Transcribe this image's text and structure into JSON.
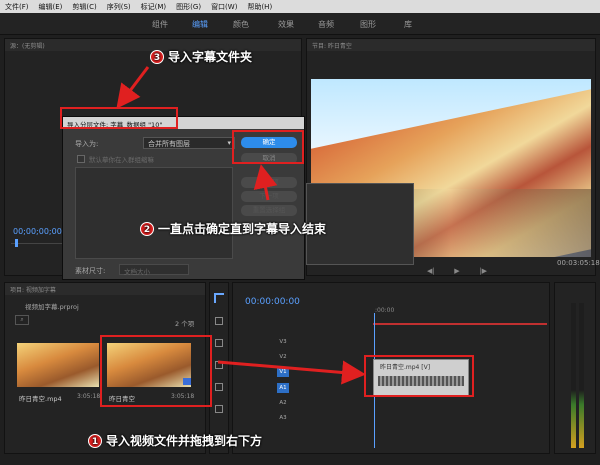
{
  "menu": [
    "文件(F)",
    "编辑(E)",
    "剪辑(C)",
    "序列(S)",
    "标记(M)",
    "图形(G)",
    "窗口(W)",
    "帮助(H)"
  ],
  "workspace_tabs": [
    "组件",
    "编辑",
    "颜色",
    "效果",
    "音频",
    "图形",
    "库"
  ],
  "source_panel": {
    "title": "源：(无剪辑)",
    "timecode": "00;00;00;00"
  },
  "program_panel": {
    "title": "节目: 昨日青空",
    "timecode_end": "00:03:05:18"
  },
  "dialog": {
    "title": "导入分层文件: 字幕_数据组 \"10\"",
    "import_as_label": "导入为:",
    "import_as_value": "合并所有图层",
    "checkbox_label": "默认摹你在入群组缩嘛",
    "footage_size_label": "素材尺寸:",
    "footage_size_value": "文档大小",
    "ok_label": "确定",
    "cancel_label": "取消",
    "prev_label": "上一项",
    "next_label": "下一项",
    "reset_label": "重置选择组"
  },
  "project_panel": {
    "title": "项目: 视频加字幕",
    "filename": "视频加字幕.prproj",
    "count": "2 个项",
    "items": [
      {
        "name": "昨日青空.mp4",
        "duration": "3:05:18"
      },
      {
        "name": "昨日青空",
        "duration": "3:05:18"
      }
    ]
  },
  "timeline": {
    "timecode": "00:00:00:00",
    "ruler_start": ":00:00",
    "tracks": [
      "V3",
      "V2",
      "V1",
      "A1",
      "A2",
      "A3"
    ],
    "clip_label": "昨日青空.mp4 [V]"
  },
  "annotations": [
    {
      "num": "1",
      "text": "导入视频文件并拖拽到右下方"
    },
    {
      "num": "2",
      "text": "一直点击确定直到字幕导入结束"
    },
    {
      "num": "3",
      "text": "导入字幕文件夹"
    }
  ],
  "colors": {
    "accent": "#2d8ceb",
    "annotation_red": "#e02020",
    "timeline_blue": "#5aa0ff"
  }
}
